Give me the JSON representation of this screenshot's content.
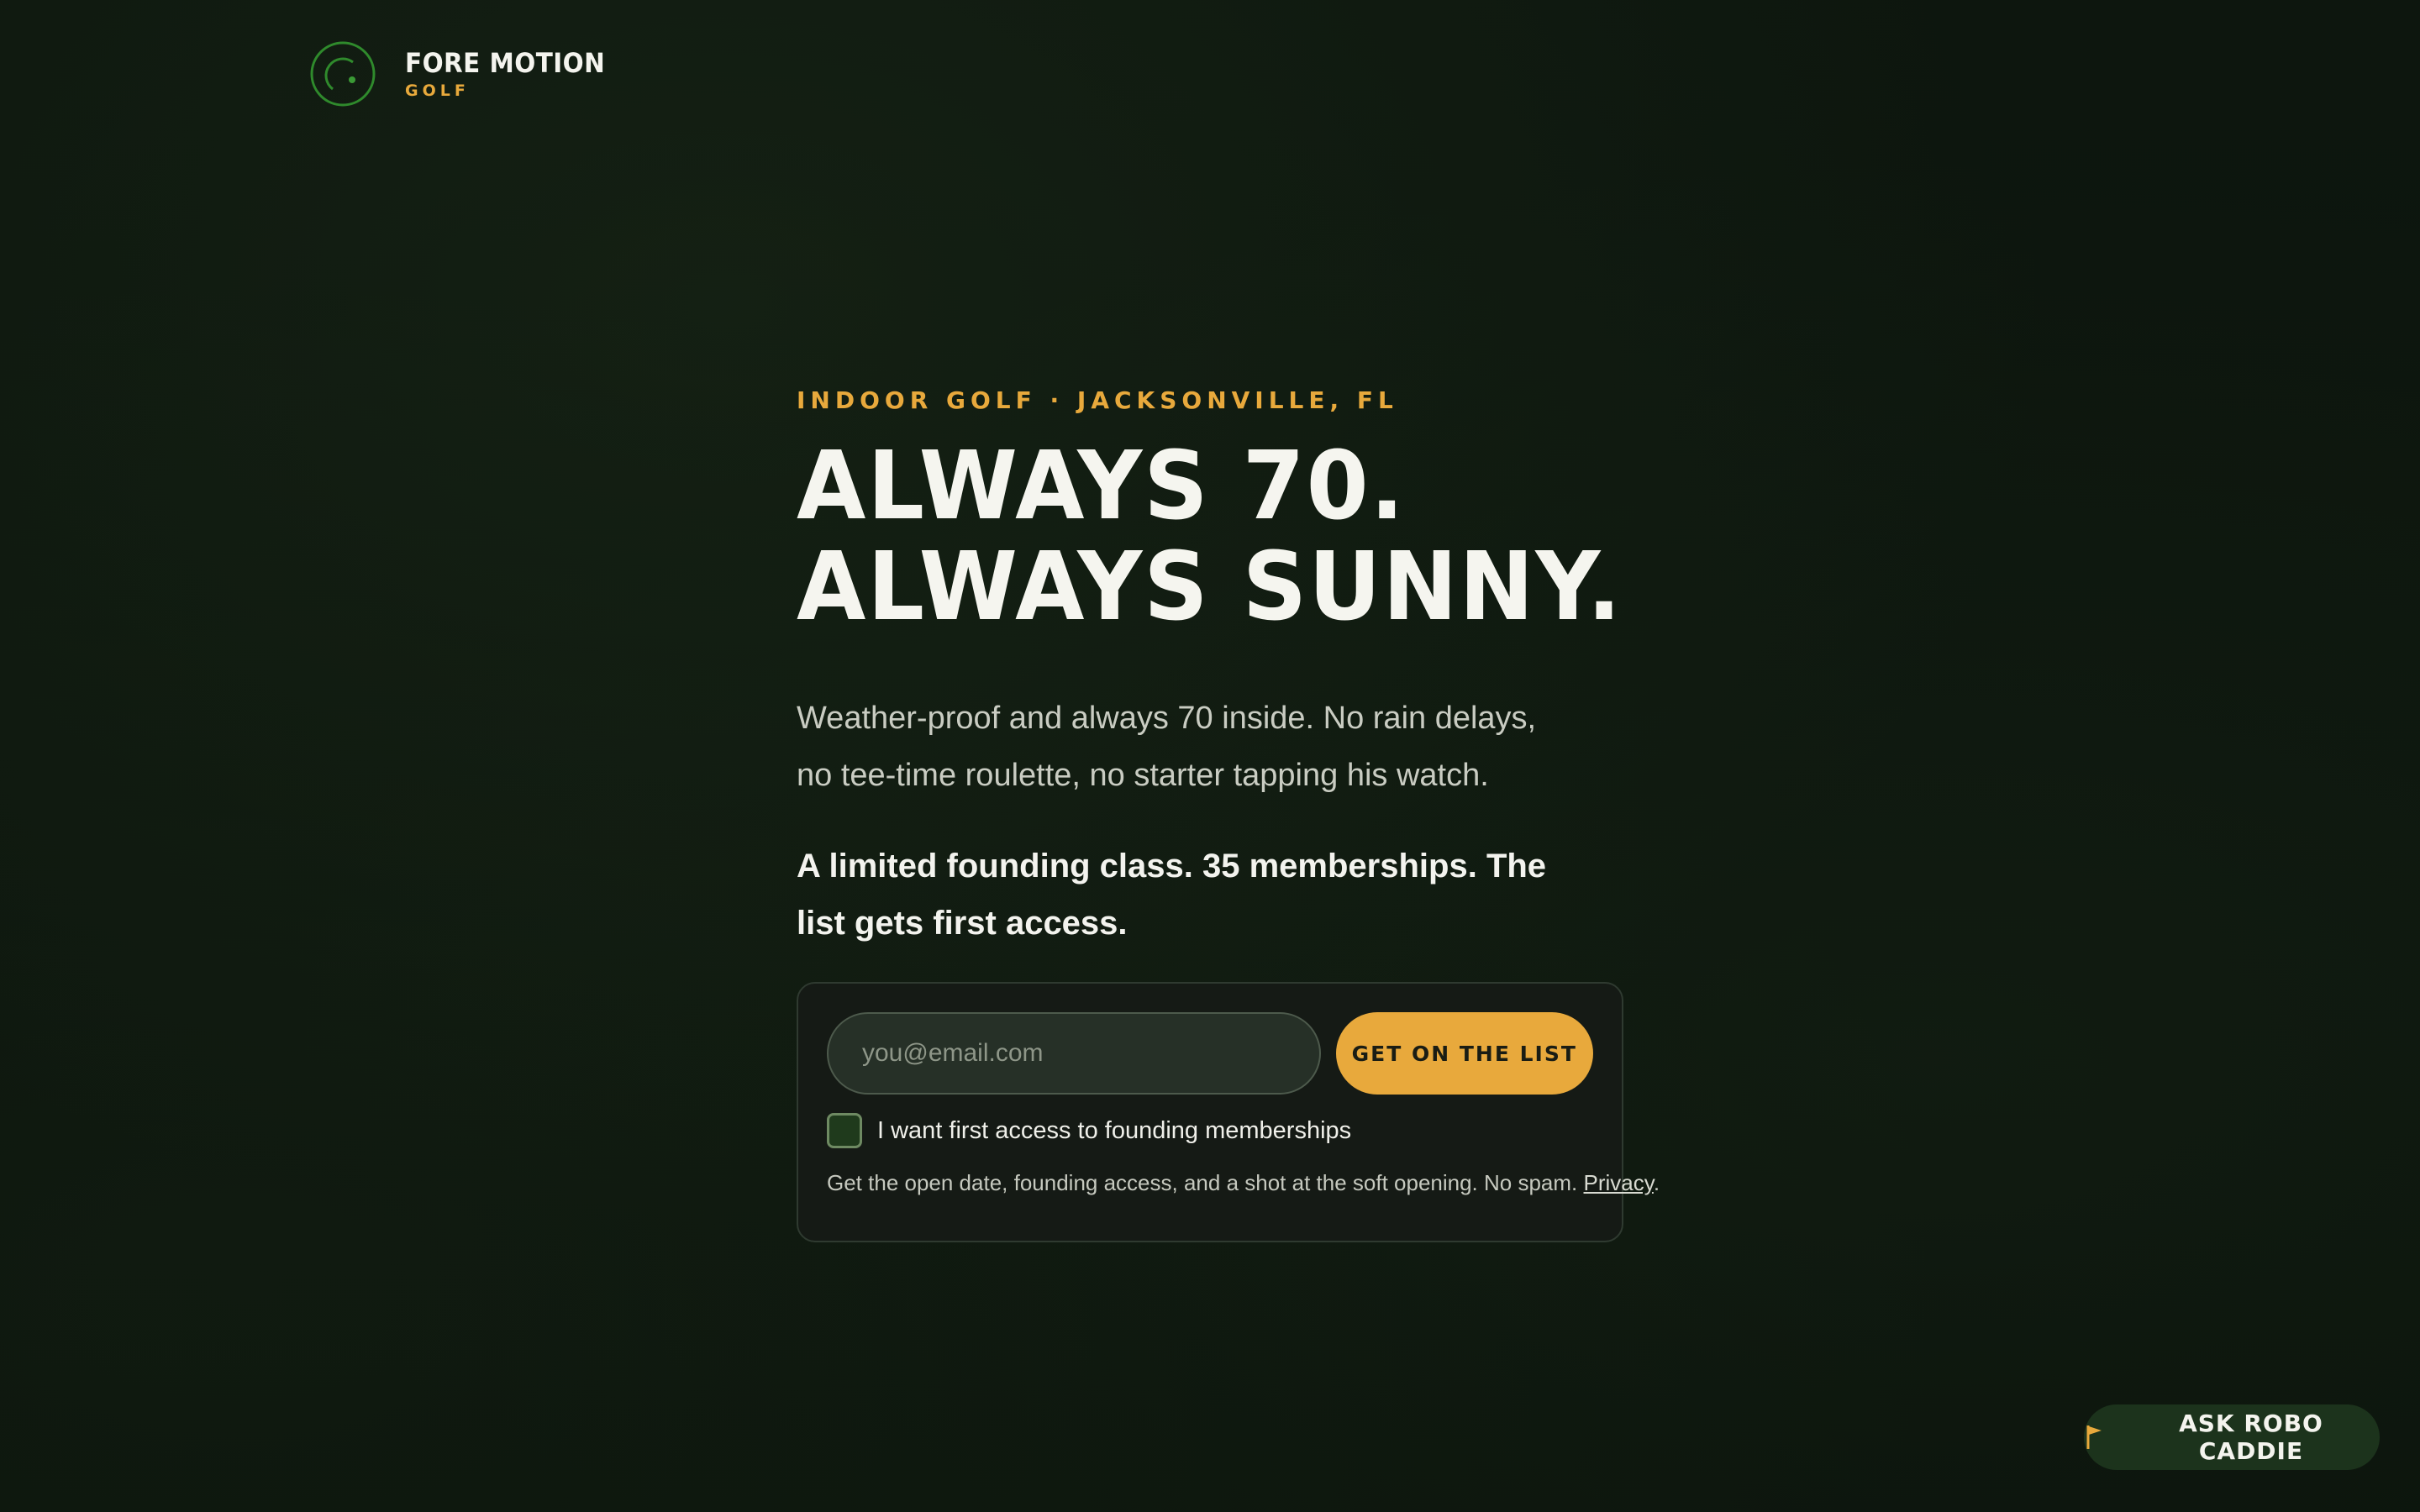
{
  "brand": {
    "name": "FORE MOTION",
    "sub": "GOLF",
    "accent": "#e8a93c",
    "mark_color": "#2f8a2c"
  },
  "hero": {
    "eyebrow": "INDOOR GOLF · JACKSONVILLE, FL",
    "headline_line1": "ALWAYS 70.",
    "headline_line2": "ALWAYS SUNNY.",
    "lede": "Weather-proof and always 70 inside. No rain delays, no tee-time roulette, no starter tapping his watch.",
    "lede_strong": "A limited founding class. 35 memberships. The list gets first access."
  },
  "form": {
    "email_placeholder": "you@email.com",
    "email_value": "",
    "submit_label": "GET ON THE LIST",
    "checkbox_label": "I want first access to founding memberships",
    "checkbox_checked": false,
    "fineprint": "Get the open date, founding access, and a shot at the soft opening. No spam.",
    "privacy_link": "Privacy",
    "fineprint_end": "."
  },
  "chat": {
    "label": "ASK ROBO CADDIE",
    "icon": "flag-icon"
  }
}
